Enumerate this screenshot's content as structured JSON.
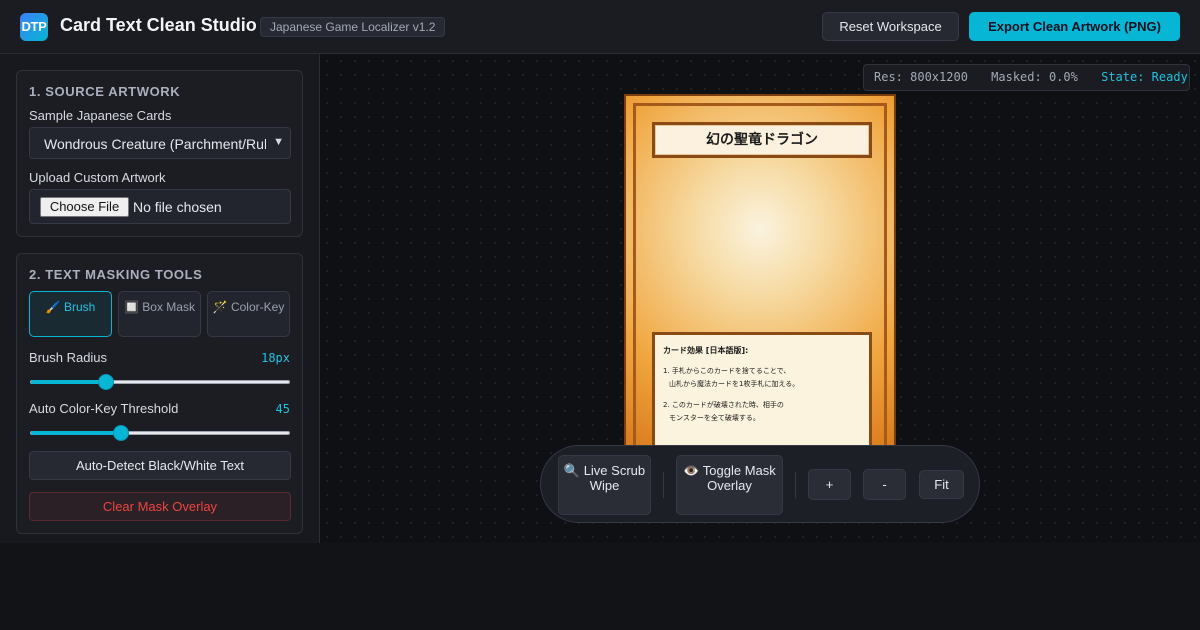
{
  "header": {
    "logo_text": "DTP",
    "title": "Card Text Clean Studio",
    "version": "Japanese Game Localizer v1.2",
    "reset_label": "Reset Workspace",
    "export_label": "Export Clean Artwork (PNG)"
  },
  "sidebar": {
    "source": {
      "title": "1. SOURCE ARTWORK",
      "sample_label": "Sample Japanese Cards",
      "sample_selected": "Wondrous Creature (Parchment/Rules)",
      "upload_label": "Upload Custom Artwork",
      "file_button": "Choose File",
      "file_status": "No file chosen"
    },
    "masking": {
      "title": "2. TEXT MASKING TOOLS",
      "tools": [
        {
          "icon": "🖌️",
          "label": "Brush",
          "active": true
        },
        {
          "icon": "🔲",
          "label": "Box Mask",
          "active": false
        },
        {
          "icon": "🪄",
          "label": "Color-Key",
          "active": false
        }
      ],
      "brush_radius_label": "Brush Radius",
      "brush_radius_value": "18px",
      "brush_radius_fraction": 0.29,
      "threshold_label": "Auto Color-Key Threshold",
      "threshold_value": "45",
      "threshold_fraction": 0.35,
      "detect_label": "Auto-Detect Black/White Text",
      "clear_label": "Clear Mask Overlay"
    }
  },
  "status": {
    "res": "Res: 800x1200",
    "masked": "Masked: 0.0%",
    "state": "State: Ready"
  },
  "card": {
    "title": "幻の聖竜ドラゴン",
    "effect_heading": "カード効果 [日本語版]:",
    "effect_lines_1": [
      "1. 手札からこのカードを捨てることで、",
      "山札から魔法カードを1枚手札に加える。"
    ],
    "effect_lines_2": [
      "2. このカードが破壊された時、相手の",
      "モンスターを全て破壊する。"
    ]
  },
  "toolbar": {
    "scrub_icon": "🔍",
    "scrub_label": "Live Scrub Wipe",
    "toggle_icon": "👁️",
    "toggle_label": "Toggle Mask Overlay",
    "zoom_in": "+",
    "zoom_out": "-",
    "fit": "Fit"
  }
}
